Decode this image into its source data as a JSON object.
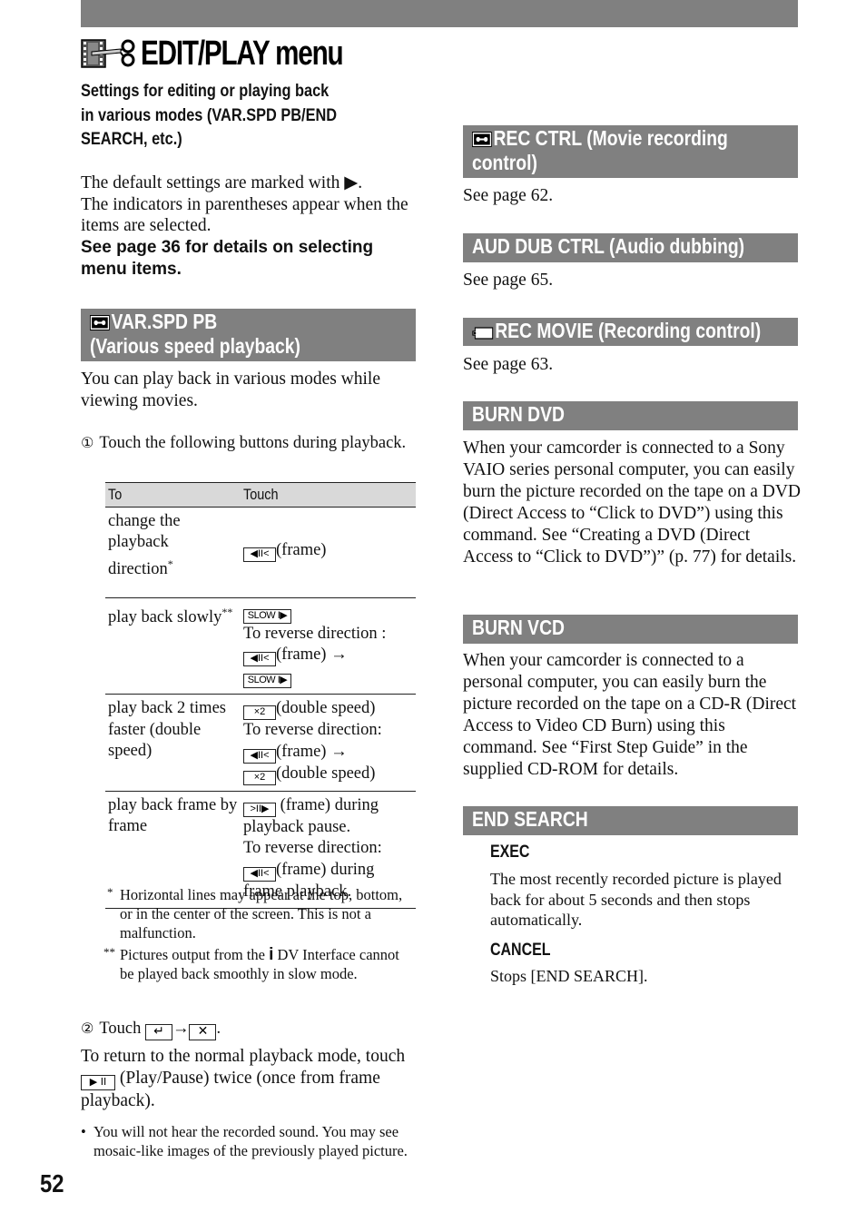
{
  "page": {
    "title": "EDIT/PLAY menu",
    "title_icon": "edit-play-icon",
    "subtitle_lines": [
      "Settings for editing or playing back",
      "in various modes (VAR.SPD PB/END",
      "SEARCH, etc.)"
    ],
    "page_number": "52"
  },
  "intro": {
    "line1": "The default settings are marked with ▶.",
    "line2": "The indicators in parentheses appear when the items are selected.",
    "bold_note": "See page 36 for details on selecting menu items."
  },
  "left": {
    "var_spd": {
      "icon": "tape-cassette-icon",
      "header_line1": "VAR.SPD PB",
      "header_line2": "(Various speed playback)",
      "description": "You can play back in various modes while viewing movies.",
      "step1_number": "①",
      "step1_text": "Touch the following buttons during playback.",
      "table": {
        "headers": [
          "To",
          "Touch"
        ],
        "rows": [
          {
            "to": "change the playback direction",
            "to_mark": "*",
            "touch": [
              {
                "button": "◀II<",
                "button_name": "frame-reverse-icon",
                "text": "(frame)"
              }
            ]
          },
          {
            "to": "play back slowly",
            "to_mark": "**",
            "touch_lines": {
              "b1": "SLOW I▶",
              "reverse": "To reverse direction :",
              "b2": "◀II<",
              "t2": "(frame) →",
              "b3": "SLOW I▶"
            }
          },
          {
            "to": "play back 2 times faster (double speed)",
            "touch_lines": {
              "b1": "×2",
              "t1": "(double speed)",
              "reverse": "To reverse direction:",
              "b2": "◀II<",
              "t2": "(frame) →",
              "b3": "×2",
              "t3": "(double speed)"
            }
          },
          {
            "to": "play back frame by frame",
            "touch_lines": {
              "b1": ">II▶",
              "t1": " (frame) during playback pause.",
              "reverse": "To reverse direction:",
              "b2": "◀II<",
              "t2": "(frame) during frame playback."
            }
          }
        ]
      },
      "footnotes": [
        {
          "mark": "*",
          "text": "Horizontal lines may appear at the top, bottom, or in the center of the screen. This is not a malfunction."
        },
        {
          "mark": "**",
          "text_before": "Pictures output from the ",
          "icon": "i-link-icon",
          "icon_glyph": "i",
          "text_after": " DV Interface cannot be played back smoothly in slow mode."
        }
      ],
      "step2_number": "②",
      "step2_text": "Touch",
      "step2_button1": "↵",
      "step2_arrow": "→",
      "step2_button2": "✕",
      "step2_end": ".",
      "return_text_before": "To return to the normal playback mode, touch ",
      "return_button": "▶ II",
      "return_text_after": " (Play/Pause) twice (once from frame playback).",
      "bullet": "•",
      "bullet_text": "You will not hear the recorded sound. You may see mosaic-like images of the previously played picture."
    }
  },
  "right": {
    "rec_ctrl": {
      "icon": "tape-cassette-icon",
      "header_line1": "REC CTRL (Movie recording",
      "header_line2": "control)",
      "text": "See page 62."
    },
    "aud_dub": {
      "header": "AUD DUB CTRL (Audio dubbing)",
      "text": "See page 65."
    },
    "rec_movie": {
      "icon": "memory-stick-icon",
      "header": "REC MOVIE (Recording control)",
      "text": "See page 63."
    },
    "burn_dvd": {
      "header": "BURN DVD",
      "text": "When your camcorder is connected to a Sony VAIO series personal computer, you can easily burn the picture recorded on the tape on a DVD (Direct Access to “Click to DVD”) using this command. See “Creating a DVD (Direct Access to “Click to DVD”)” (p. 77) for details."
    },
    "burn_vcd": {
      "header": "BURN VCD",
      "text": "When your camcorder is connected to a personal computer, you can easily burn the picture recorded on the tape on a CD-R (Direct Access to Video CD Burn) using this command. See “First Step Guide” in the supplied CD-ROM for details."
    },
    "end_search": {
      "header": "END SEARCH",
      "options": [
        {
          "label": "EXEC",
          "text": "The most recently recorded picture is played back for about 5 seconds and then stops automatically."
        },
        {
          "label": "CANCEL",
          "text": "Stops [END SEARCH]."
        }
      ]
    }
  },
  "colors": {
    "header_bar": "#808080",
    "table_header": "#d9d9d9",
    "text": "#111111",
    "header_text": "#ffffff"
  }
}
